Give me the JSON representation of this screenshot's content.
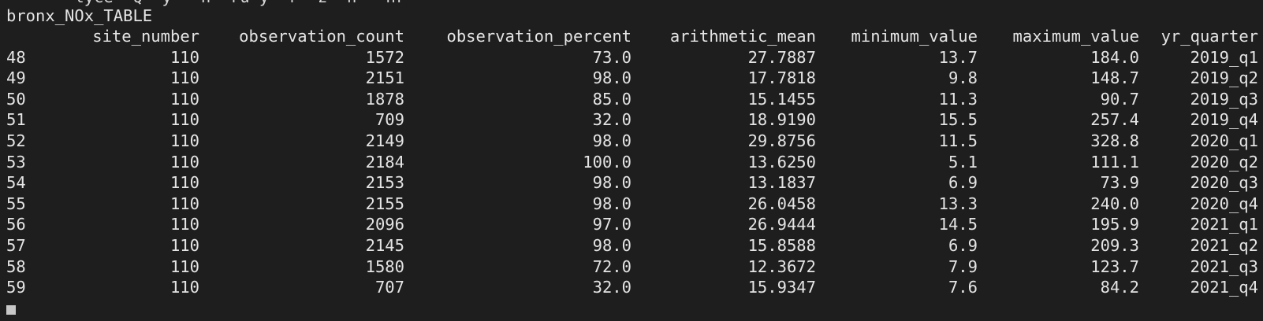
{
  "terminal": {
    "cut_line": "       lyce  Q  y   n  ru y  r  z  n   nr",
    "title": "bronx_NOx_TABLE"
  },
  "table": {
    "columns": [
      "",
      "site_number",
      "observation_count",
      "observation_percent",
      "arithmetic_mean",
      "minimum_value",
      "maximum_value",
      "yr_quarter"
    ],
    "rows": [
      [
        "48",
        "110",
        "1572",
        "73.0",
        "27.7887",
        "13.7",
        "184.0",
        "2019_q1"
      ],
      [
        "49",
        "110",
        "2151",
        "98.0",
        "17.7818",
        "9.8",
        "148.7",
        "2019_q2"
      ],
      [
        "50",
        "110",
        "1878",
        "85.0",
        "15.1455",
        "11.3",
        "90.7",
        "2019_q3"
      ],
      [
        "51",
        "110",
        "709",
        "32.0",
        "18.9190",
        "15.5",
        "257.4",
        "2019_q4"
      ],
      [
        "52",
        "110",
        "2149",
        "98.0",
        "29.8756",
        "11.5",
        "328.8",
        "2020_q1"
      ],
      [
        "53",
        "110",
        "2184",
        "100.0",
        "13.6250",
        "5.1",
        "111.1",
        "2020_q2"
      ],
      [
        "54",
        "110",
        "2153",
        "98.0",
        "13.1837",
        "6.9",
        "73.9",
        "2020_q3"
      ],
      [
        "55",
        "110",
        "2155",
        "98.0",
        "26.0458",
        "13.3",
        "240.0",
        "2020_q4"
      ],
      [
        "56",
        "110",
        "2096",
        "97.0",
        "26.9444",
        "14.5",
        "195.9",
        "2021_q1"
      ],
      [
        "57",
        "110",
        "2145",
        "98.0",
        "15.8588",
        "6.9",
        "209.3",
        "2021_q2"
      ],
      [
        "58",
        "110",
        "1580",
        "72.0",
        "12.3672",
        "7.9",
        "123.7",
        "2021_q3"
      ],
      [
        "59",
        "110",
        "707",
        "32.0",
        "15.9347",
        "7.6",
        "84.2",
        "2021_q4"
      ]
    ]
  },
  "colors": {
    "background": "#1e1e1e",
    "text": "#e4e4e4",
    "cursor": "#c8c8c8"
  }
}
